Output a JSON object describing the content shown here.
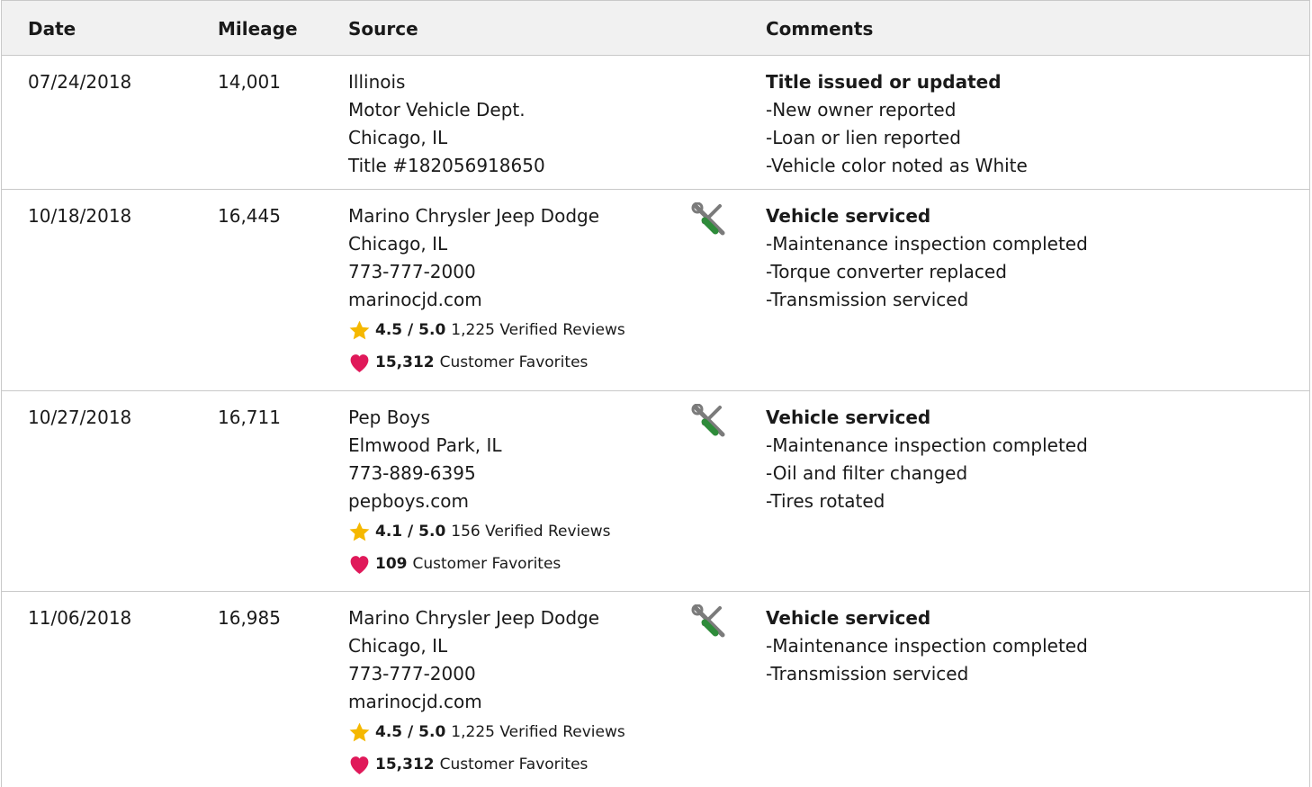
{
  "table": {
    "columns": {
      "date": "Date",
      "mileage": "Mileage",
      "source": "Source",
      "comments": "Comments"
    },
    "rows": [
      {
        "date": "07/24/2018",
        "mileage": "14,001",
        "source": [
          "Illinois",
          "Motor Vehicle Dept.",
          "Chicago, IL",
          "Title #182056918650"
        ],
        "comment_title": "Title issued or updated",
        "comment_items": [
          "-New owner reported",
          "-Loan or lien reported",
          "-Vehicle color noted as White"
        ]
      },
      {
        "date": "10/18/2018",
        "mileage": "16,445",
        "icon": "service-tools-icon",
        "source": [
          "Marino Chrysler Jeep Dodge",
          "Chicago, IL",
          "773-777-2000",
          "marinocjd.com"
        ],
        "rating": "4.5 / 5.0",
        "reviews": "1,225 Verified Reviews",
        "favorites_count": "15,312",
        "favorites_label": "Customer Favorites",
        "comment_title": "Vehicle serviced",
        "comment_items": [
          "-Maintenance inspection completed",
          "-Torque converter replaced",
          "-Transmission serviced"
        ]
      },
      {
        "date": "10/27/2018",
        "mileage": "16,711",
        "icon": "service-tools-icon",
        "source": [
          "Pep Boys",
          "Elmwood Park, IL",
          "773-889-6395",
          "pepboys.com"
        ],
        "rating": "4.1 / 5.0",
        "reviews": "156 Verified Reviews",
        "favorites_count": "109",
        "favorites_label": "Customer Favorites",
        "comment_title": "Vehicle serviced",
        "comment_items": [
          "-Maintenance inspection completed",
          "-Oil and filter changed",
          "-Tires rotated"
        ]
      },
      {
        "date": "11/06/2018",
        "mileage": "16,985",
        "icon": "service-tools-icon",
        "source": [
          "Marino Chrysler Jeep Dodge",
          "Chicago, IL",
          "773-777-2000",
          "marinocjd.com"
        ],
        "rating": "4.5 / 5.0",
        "reviews": "1,225 Verified Reviews",
        "favorites_count": "15,312",
        "favorites_label": "Customer Favorites",
        "comment_title": "Vehicle serviced",
        "comment_items": [
          "-Maintenance inspection completed",
          "-Transmission serviced"
        ]
      }
    ]
  },
  "colors": {
    "star": "#f5b800",
    "heart": "#e0195a",
    "wrench": "#7b7b7b",
    "screwdriver": "#2e8b3a",
    "header_bg": "#f1f1f1",
    "border": "#c9c9c9"
  }
}
